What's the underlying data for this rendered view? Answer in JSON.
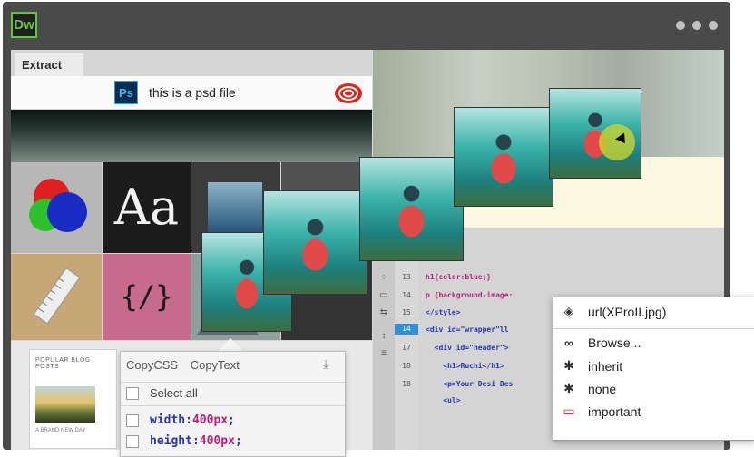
{
  "app": {
    "logo_text": "Dw"
  },
  "extract_panel": {
    "tab_label": "Extract",
    "file_label": "this is a psd file",
    "ps_icon_text": "Ps",
    "tiles": {
      "typography_sample": "Aa",
      "code_symbol": "{/}"
    },
    "post_card": {
      "title": "POPULAR BLOG POSTS",
      "subtitle": "A BRAND NEW DAY"
    }
  },
  "copy_panel": {
    "tabs": [
      "CopyCSS",
      "CopyText"
    ],
    "select_all_label": "Select all",
    "properties": [
      {
        "name": "width",
        "value": "400px"
      },
      {
        "name": "height",
        "value": "400px"
      }
    ]
  },
  "code_editor": {
    "lines": [
      {
        "num": "13",
        "text": "h1{color:blue;}"
      },
      {
        "num": "14",
        "text": "p {background-image:"
      },
      {
        "num": "15",
        "text": "</style>"
      },
      {
        "num": "14",
        "text": "<div id=\"wrapper\"ll",
        "active": true
      },
      {
        "num": "17",
        "text": "  <div id=\"header\">"
      },
      {
        "num": "18",
        "text": "    <h1>Ruchi</h1>"
      },
      {
        "num": "18",
        "text": "    <p>Your Desi Des"
      },
      {
        "num": "",
        "text": "    <ul>"
      }
    ]
  },
  "context_menu": {
    "items": [
      {
        "label": "url(XProII.jpg)",
        "icon": "layers-icon"
      },
      {
        "label": "Browse...",
        "icon": "link-icon"
      },
      {
        "label": "inherit",
        "icon": "asterisk-icon"
      },
      {
        "label": "none",
        "icon": "asterisk-icon"
      },
      {
        "label": "important",
        "icon": "flag-icon"
      }
    ]
  },
  "colors": {
    "dw_green": "#63c53f",
    "ps_blue": "#42b3f5",
    "active_line": "#2f8fd7",
    "code_tag": "#2a35b8",
    "code_value": "#b7237a"
  }
}
